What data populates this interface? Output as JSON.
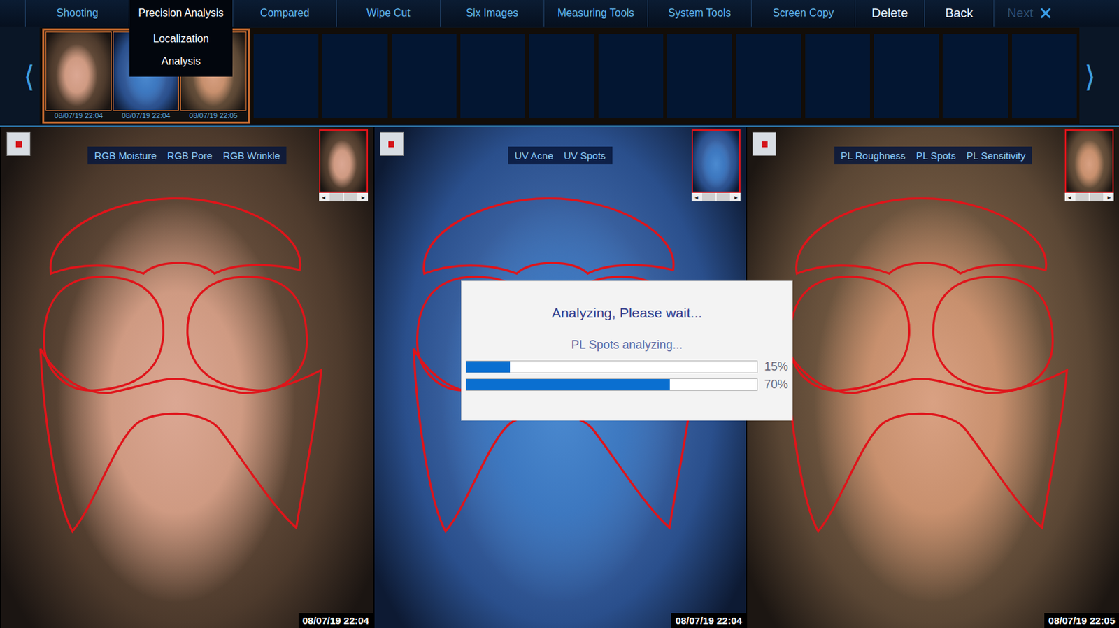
{
  "menu": [
    {
      "label": "Shooting",
      "selected": false,
      "disabled": false
    },
    {
      "label": "Precision Analysis",
      "selected": true,
      "disabled": false
    },
    {
      "label": "Compared",
      "selected": false,
      "disabled": false
    },
    {
      "label": "Wipe Cut",
      "selected": false,
      "disabled": false
    },
    {
      "label": "Six Images",
      "selected": false,
      "disabled": false
    },
    {
      "label": "Measuring Tools",
      "selected": false,
      "disabled": false
    },
    {
      "label": "System Tools",
      "selected": false,
      "disabled": false
    },
    {
      "label": "Screen Copy",
      "selected": false,
      "disabled": false
    },
    {
      "label": "Delete",
      "selected": false,
      "disabled": false
    },
    {
      "label": "Back",
      "selected": false,
      "disabled": false
    },
    {
      "label": "Next",
      "selected": false,
      "disabled": true
    }
  ],
  "dropdown": {
    "items": [
      "Localization",
      "Analysis"
    ]
  },
  "strip": {
    "prev": "⟨",
    "next": "⟩",
    "empty_slots": 12
  },
  "thumbnails": [
    {
      "date": "08/07/19 22:04",
      "kind": "rgb",
      "selected": true
    },
    {
      "date": "08/07/19 22:04",
      "kind": "uv",
      "selected": true
    },
    {
      "date": "08/07/19 22:05",
      "kind": "pl",
      "selected": true
    }
  ],
  "scroller": {
    "left": "◂",
    "right": "▸"
  },
  "panels": [
    {
      "kind": "rgb",
      "modes": [
        "RGB Moisture",
        "RGB Pore",
        "RGB Wrinkle"
      ],
      "time": "08/07/19 22:04"
    },
    {
      "kind": "uv",
      "modes": [
        "UV Acne",
        "UV Spots"
      ],
      "time": "08/07/19 22:04"
    },
    {
      "kind": "pl",
      "modes": [
        "PL Roughness",
        "PL Spots",
        "PL Sensitivity"
      ],
      "time": "08/07/19 22:05"
    }
  ],
  "dialog": {
    "title": "Analyzing, Please wait...",
    "status": "PL Spots analyzing...",
    "bars": [
      {
        "level": 0.15,
        "reading": "15%"
      },
      {
        "level": 0.7,
        "reading": "70%"
      }
    ]
  }
}
